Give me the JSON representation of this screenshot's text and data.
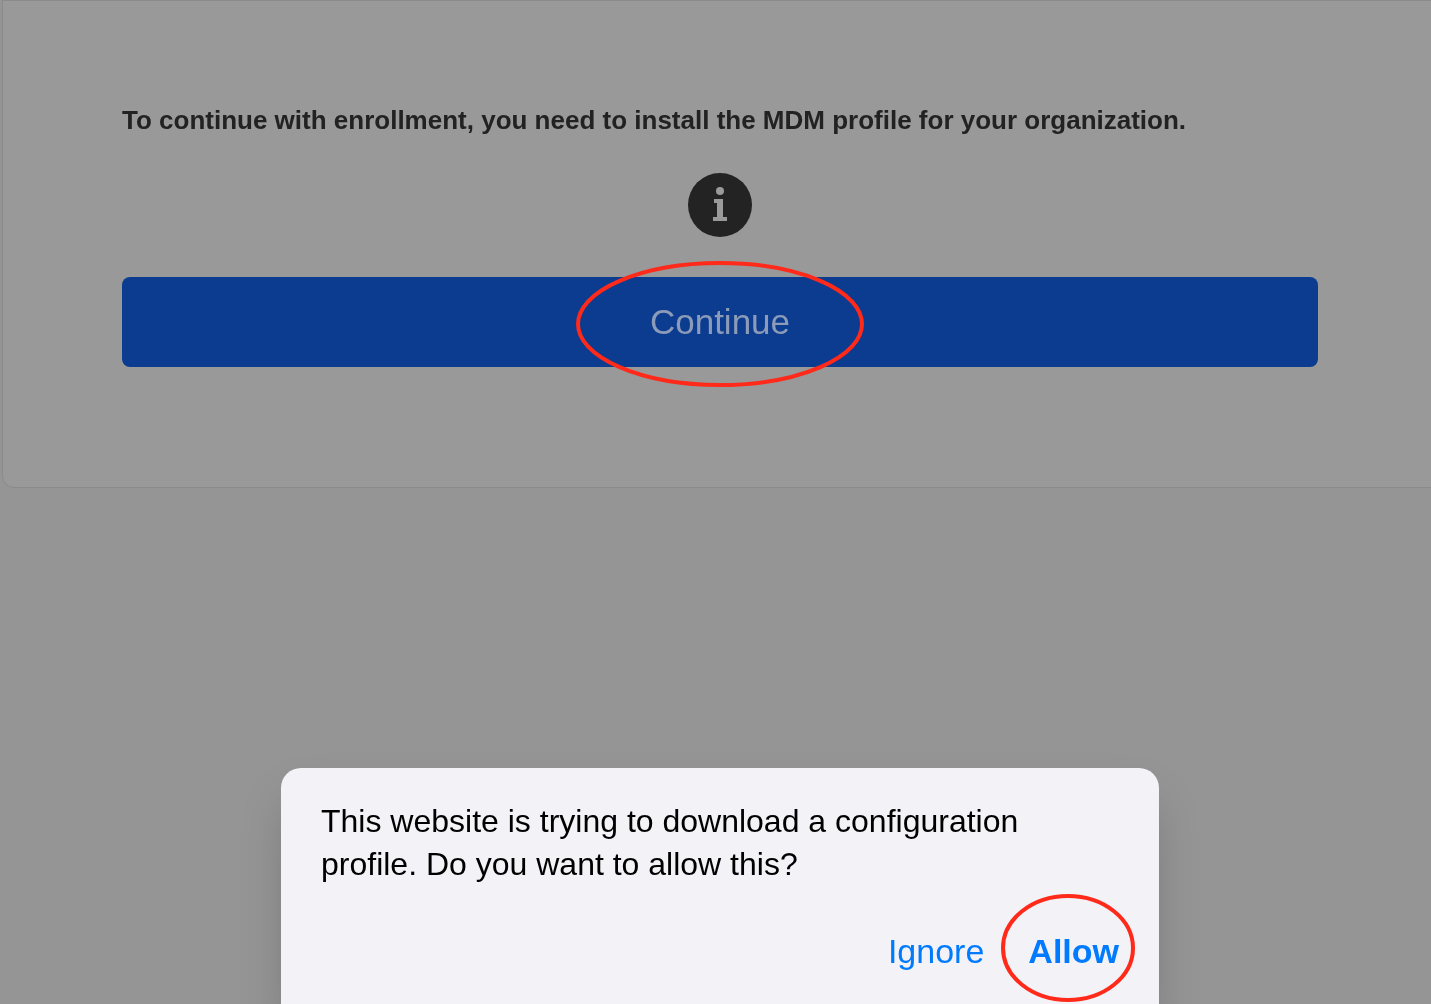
{
  "page": {
    "message": "To continue with enrollment, you need to install the MDM profile for your organization.",
    "continue_button": {
      "label": "Continue",
      "highlighted": true
    }
  },
  "alert": {
    "message": "This website is trying to download a configuration profile. Do you want to allow this?",
    "buttons": [
      {
        "label": "Ignore",
        "kind": "normal",
        "highlighted": false
      },
      {
        "label": "Allow",
        "kind": "default",
        "highlighted": true
      }
    ]
  }
}
